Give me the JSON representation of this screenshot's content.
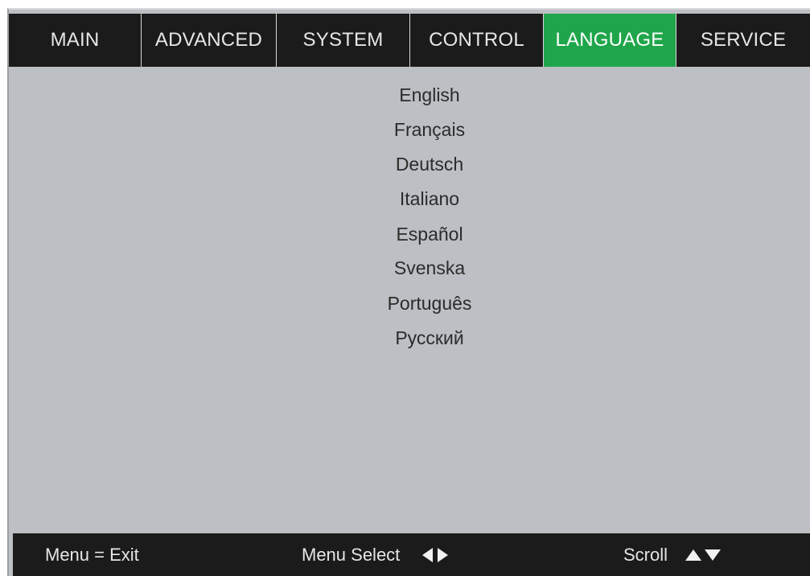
{
  "tabs": [
    {
      "label": "MAIN",
      "active": false
    },
    {
      "label": "ADVANCED",
      "active": false
    },
    {
      "label": "SYSTEM",
      "active": false
    },
    {
      "label": "CONTROL",
      "active": false
    },
    {
      "label": "LANGUAGE",
      "active": true
    },
    {
      "label": "SERVICE",
      "active": false
    }
  ],
  "languages": [
    "English",
    "Français",
    "Deutsch",
    "Italiano",
    "Español",
    "Svenska",
    "Português",
    "Русский"
  ],
  "footer": {
    "exit_label": "Menu = Exit",
    "select_label": "Menu Select",
    "scroll_label": "Scroll"
  },
  "colors": {
    "active_tab": "#1fa64a",
    "bar_background": "#1b1b1b",
    "panel_background": "#bcbfc3"
  },
  "icons": {
    "select": [
      "triangle-left-icon",
      "triangle-right-icon"
    ],
    "scroll": [
      "triangle-up-icon",
      "triangle-down-icon"
    ]
  }
}
